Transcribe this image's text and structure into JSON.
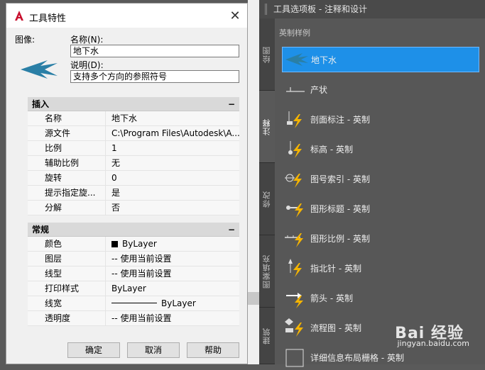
{
  "dialog": {
    "title": "工具特性",
    "close_glyph": "✕",
    "image_label": "图像:",
    "name_label": "名称(N):",
    "name_value": "地下水",
    "desc_label": "说明(D):",
    "desc_value": "支持多个方向的参照符号",
    "buttons": {
      "ok": "确定",
      "cancel": "取消",
      "help": "帮助"
    }
  },
  "insert_section": {
    "title": "插入",
    "collapse": "−",
    "rows": [
      {
        "name": "名称",
        "value": "地下水"
      },
      {
        "name": "源文件",
        "value": "C:\\Program Files\\Autodesk\\A..."
      },
      {
        "name": "比例",
        "value": "1"
      },
      {
        "name": "辅助比例",
        "value": "无"
      },
      {
        "name": "旋转",
        "value": "0"
      },
      {
        "name": "提示指定旋...",
        "value": "是"
      },
      {
        "name": "分解",
        "value": "否"
      }
    ]
  },
  "general_section": {
    "title": "常规",
    "collapse": "−",
    "rows": [
      {
        "name": "颜色",
        "value": "ByLayer"
      },
      {
        "name": "图层",
        "value": "-- 使用当前设置"
      },
      {
        "name": "线型",
        "value": "-- 使用当前设置"
      },
      {
        "name": "打印样式",
        "value": "ByLayer"
      },
      {
        "name": "线宽",
        "value": "ByLayer"
      },
      {
        "name": "透明度",
        "value": "-- 使用当前设置"
      }
    ]
  },
  "palette": {
    "title": "工具选项板 - 注释和设计",
    "group_label": "英制样例",
    "tabs": [
      {
        "label": "绘图"
      },
      {
        "label": "注释"
      },
      {
        "label": "修改"
      },
      {
        "label": "图案填充"
      },
      {
        "label": "建筑"
      }
    ],
    "tools": [
      {
        "label": "地下水"
      },
      {
        "label": "产状"
      },
      {
        "label": "剖面标注 - 英制"
      },
      {
        "label": "标高 - 英制"
      },
      {
        "label": "图号索引 - 英制"
      },
      {
        "label": "图形标题 - 英制"
      },
      {
        "label": "图形比例 - 英制"
      },
      {
        "label": "指北针 - 英制"
      },
      {
        "label": "箭头 - 英制"
      },
      {
        "label": "流程图 - 英制"
      },
      {
        "label": "详细信息布局栅格 - 英制"
      }
    ]
  },
  "watermark": {
    "main": "Bai 经验",
    "sub": "jingyan.baidu.com"
  },
  "colors": {
    "accent": "#1e90e8",
    "arrow": "#2a7fa6",
    "bolt": "#f5b400"
  }
}
